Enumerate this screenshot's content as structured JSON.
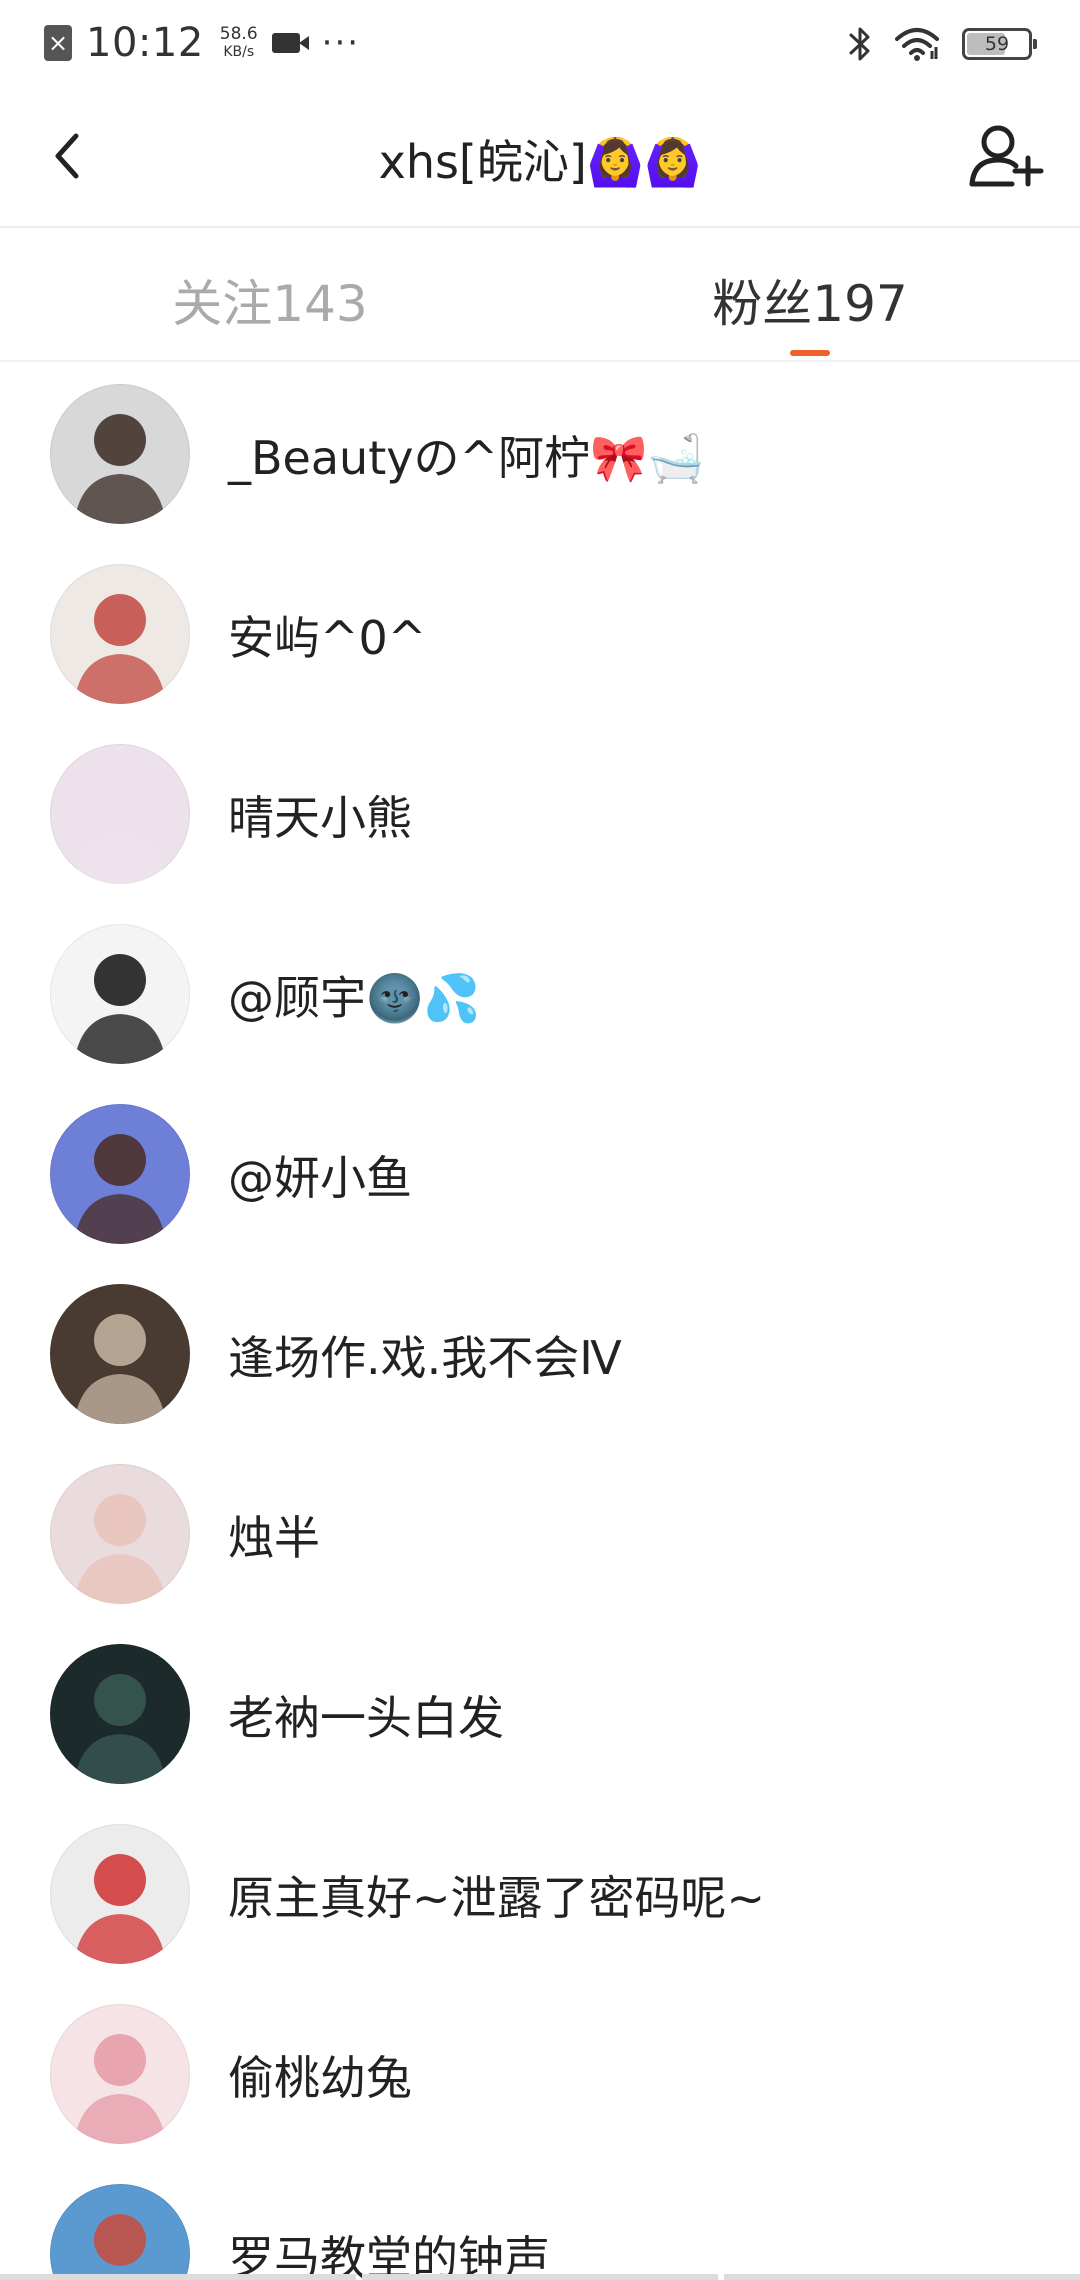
{
  "status_bar": {
    "time": "10:12",
    "net_speed_value": "58.6",
    "net_speed_unit": "KB/s",
    "more": "···",
    "battery": "59",
    "battery_level": 0.59,
    "icons": [
      "sim-off-icon",
      "video-icon",
      "bluetooth-icon",
      "wifi-icon",
      "battery-icon"
    ]
  },
  "header": {
    "title": "xhs[皖沁]🙆‍♀️🙆‍♀️",
    "back_icon": "back-arrow-icon",
    "add_icon": "add-friend-icon"
  },
  "tabs": [
    {
      "label": "关注143",
      "active": false
    },
    {
      "label": "粉丝197",
      "active": true
    }
  ],
  "accent_color": "#f0602a",
  "users": [
    {
      "name": "_Beautyの^阿柠🎀🛁",
      "avatar_bg": "#d8d8d8",
      "avatar_fg": "#3a2a24"
    },
    {
      "name": "安屿^0^",
      "avatar_bg": "#efe9e6",
      "avatar_fg": "#c2473f"
    },
    {
      "name": "晴天小熊",
      "avatar_bg": "#ede1ec",
      "avatar_fg": "#ede1ec"
    },
    {
      "name": "@顾宇🌚💦",
      "avatar_bg": "#f4f4f4",
      "avatar_fg": "#111111"
    },
    {
      "name": "@妍小鱼",
      "avatar_bg": "#6e7fd8",
      "avatar_fg": "#4a2a22"
    },
    {
      "name": "逢场作.戏.我不会Ⅳ",
      "avatar_bg": "#4a3b32",
      "avatar_fg": "#c9b7a4"
    },
    {
      "name": "烛半",
      "avatar_bg": "#eadcdc",
      "avatar_fg": "#e8c2b8"
    },
    {
      "name": "老衲一头白发",
      "avatar_bg": "#1c2a2c",
      "avatar_fg": "#3a5a54"
    },
    {
      "name": "原主真好~泄露了密码呢~",
      "avatar_bg": "#ececec",
      "avatar_fg": "#d03030"
    },
    {
      "name": "偷桃幼兔",
      "avatar_bg": "#f5e3e6",
      "avatar_fg": "#e59aa6"
    },
    {
      "name": "罗马教堂的钟声",
      "avatar_bg": "#5a9ad0",
      "avatar_fg": "#c94a3c"
    }
  ]
}
